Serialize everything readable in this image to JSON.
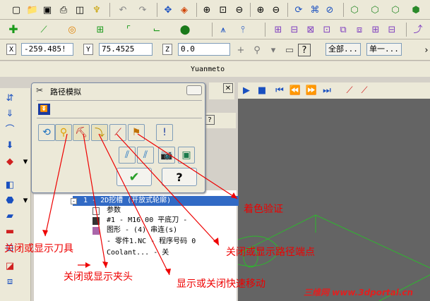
{
  "app": {
    "title": "Yuanmeto"
  },
  "coords": {
    "x_label": "X",
    "x_value": "-259.485!",
    "y_label": "Y",
    "y_value": "75.4525",
    "z_label": "Z",
    "z_value": "0.0"
  },
  "toolbar3": {
    "filter_value": "全部...",
    "mode_value": "单一..."
  },
  "dialog": {
    "title": "路径模拟",
    "ok_icon": "check-icon",
    "help_label": "?"
  },
  "tree": {
    "items": [
      "1 - 2D挖槽 (开放式轮廓)",
      "参数",
      "#1 - M16.00 平底刀 -",
      "图形 - (4) 串连(s)",
      "- 零件1.NC - 程序号码 0",
      "Coolant... - 关"
    ]
  },
  "annotations": {
    "shading": "着色验证",
    "endpoints": "关闭或显示路径端点",
    "tool": "关闭或显示刀具",
    "holder": "关闭或显示夹头",
    "rapid": "显示或关闭快速移动"
  },
  "watermark": {
    "text": "三维网 www.3dportal.cn"
  },
  "colors": {
    "annotation": "#e00000",
    "viewport": "#646464",
    "geometry": "#2db82d"
  }
}
